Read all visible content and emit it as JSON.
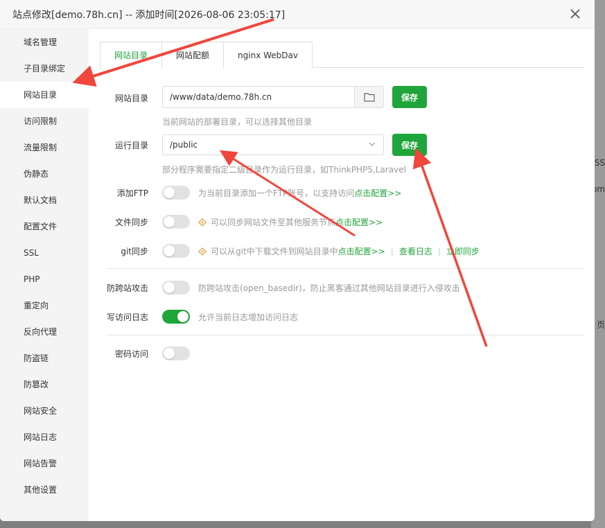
{
  "window": {
    "title": "站点修改[demo.78h.cn] -- 添加时间[2026-08-06 23:05:17]"
  },
  "background_peek": [
    "SS",
    "om",
    "页"
  ],
  "sidebar": {
    "items": [
      {
        "label": "域名管理",
        "active": false
      },
      {
        "label": "子目录绑定",
        "active": false
      },
      {
        "label": "网站目录",
        "active": true
      },
      {
        "label": "访问限制",
        "active": false
      },
      {
        "label": "流量限制",
        "active": false
      },
      {
        "label": "伪静态",
        "active": false
      },
      {
        "label": "默认文档",
        "active": false
      },
      {
        "label": "配置文件",
        "active": false
      },
      {
        "label": "SSL",
        "active": false
      },
      {
        "label": "PHP",
        "active": false
      },
      {
        "label": "重定向",
        "active": false
      },
      {
        "label": "反向代理",
        "active": false
      },
      {
        "label": "防盗链",
        "active": false
      },
      {
        "label": "防篡改",
        "active": false
      },
      {
        "label": "网站安全",
        "active": false
      },
      {
        "label": "网站日志",
        "active": false
      },
      {
        "label": "网站告警",
        "active": false
      },
      {
        "label": "其他设置",
        "active": false
      }
    ]
  },
  "tabs": [
    {
      "label": "网站目录",
      "active": true
    },
    {
      "label": "网站配额",
      "active": false
    },
    {
      "label": "nginx WebDav",
      "active": false
    }
  ],
  "form": {
    "site_dir": {
      "label": "网站目录",
      "value": "/www/data/demo.78h.cn",
      "save_label": "保存",
      "hint": "当前网站的部署目录，可以选择其他目录"
    },
    "run_dir": {
      "label": "运行目录",
      "value": "/public",
      "save_label": "保存",
      "hint": "部分程序需要指定二级目录作为运行目录，如ThinkPHP5,Laravel"
    },
    "ftp": {
      "label": "添加FTP",
      "enabled": false,
      "desc": "为当前目录添加一个FTP账号，以支持访问",
      "link": "点击配置>>"
    },
    "file_sync": {
      "label": "文件同步",
      "enabled": false,
      "desc": "可以同步网站文件至其他服务节点",
      "link": "点击配置>>"
    },
    "git_sync": {
      "label": "git同步",
      "enabled": false,
      "desc": "可以从git中下载文件到网站目录中",
      "link": "点击配置>>",
      "log_link": "查看日志",
      "sync_link": "立即同步"
    },
    "anti_cross": {
      "label": "防跨站攻击",
      "enabled": false,
      "desc": "防跨站攻击(open_basedir)，防止黑客通过其他网站目录进行入侵攻击"
    },
    "access_log": {
      "label": "写访问日志",
      "enabled": true,
      "desc": "允许当前日志增加访问日志"
    },
    "password_access": {
      "label": "密码访问",
      "enabled": false
    }
  },
  "colors": {
    "accent": "#20a53a",
    "annotation_arrow": "#f0463c"
  },
  "icons": {
    "close": "close-icon",
    "folder": "folder-icon",
    "dropdown": "chevron-down-icon",
    "tip": "tip-icon"
  }
}
